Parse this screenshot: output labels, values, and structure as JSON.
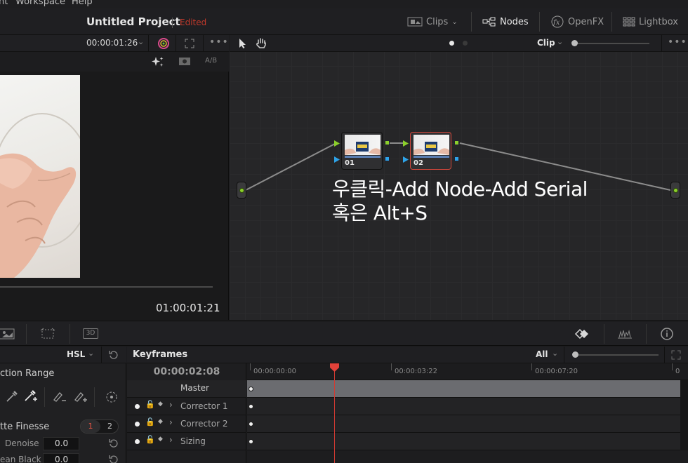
{
  "menu": {
    "items": [
      "nt",
      "Workspace",
      "Help"
    ]
  },
  "header": {
    "project_title": "Untitled Project",
    "status": "Edited",
    "buttons": {
      "clips": "Clips",
      "nodes": "Nodes",
      "openfx": "OpenFX",
      "lightbox": "Lightbox"
    }
  },
  "viewer": {
    "timecode_top": "00:00:01:26",
    "ab_label": "A/B",
    "timecode_bottom": "01:00:01:21"
  },
  "node_editor": {
    "mode": "Clip",
    "nodes": [
      {
        "id": "01",
        "selected": false
      },
      {
        "id": "02",
        "selected": true
      }
    ],
    "annotation_line1": "우클릭-Add Node-Add Serial",
    "annotation_line2": "혹은 Alt+S",
    "colors": {
      "input_port": "#8ccf2b",
      "key_port": "#2ea3e8",
      "selection": "#d2473b"
    }
  },
  "tool_strip": {
    "3d_label": "3D"
  },
  "qualifier": {
    "mode": "HSL",
    "section_selection": "ction Range",
    "section_finesse": "tte Finesse",
    "finesse_tabs": [
      "1",
      "2"
    ],
    "denoise_label": "Denoise",
    "denoise_value": "0.0",
    "clean_black_label": "ean Black",
    "clean_black_value": "0.0"
  },
  "keyframes": {
    "title": "Keyframes",
    "filter": "All",
    "current_timecode": "00:00:02:08",
    "ruler": [
      "00:00:00:00",
      "00:00:03:22",
      "00:00:07:20",
      "0"
    ],
    "tracks": [
      {
        "name": "Master"
      },
      {
        "name": "Corrector 1"
      },
      {
        "name": "Corrector 2"
      },
      {
        "name": "Sizing"
      }
    ],
    "colors": {
      "playhead": "#d13a32"
    }
  }
}
